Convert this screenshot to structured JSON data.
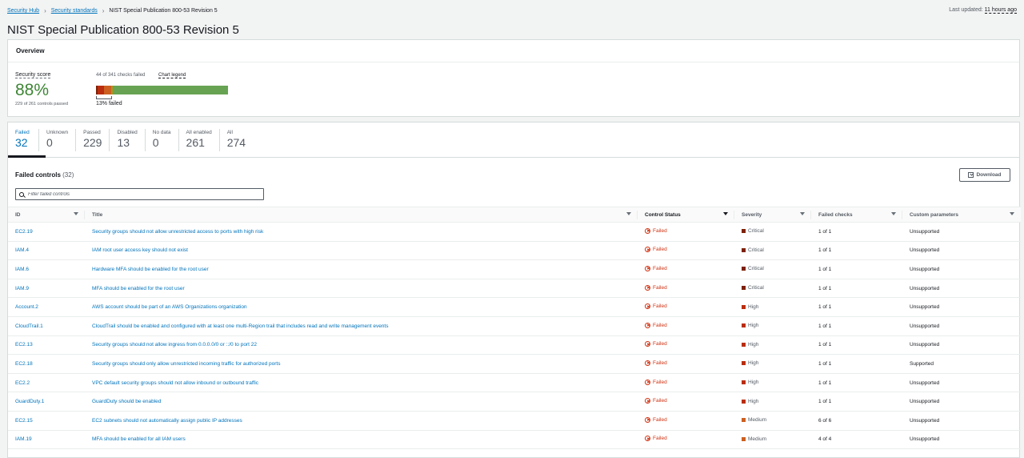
{
  "breadcrumb": {
    "items": [
      "Security Hub",
      "Security standards"
    ],
    "current": "NIST Special Publication 800-53 Revision 5"
  },
  "last_updated": {
    "label": "Last updated:",
    "value": "11 hours ago"
  },
  "page_title": "NIST Special Publication 800-53 Revision 5",
  "overview": {
    "header": "Overview",
    "score_label": "Security score",
    "score_value": "88%",
    "score_sub": "229 of 261 controls passed",
    "checks_failed": "44 of 341 checks failed",
    "chart_legend": "Chart legend",
    "failed_pct_label": "13% failed",
    "bar_segments": [
      {
        "severity": "critical",
        "fraction": 0.012,
        "color": "#7d2105"
      },
      {
        "severity": "high",
        "fraction": 0.05,
        "color": "#ba2e0f"
      },
      {
        "severity": "medium",
        "fraction": 0.055,
        "color": "#cc5f21"
      },
      {
        "severity": "low",
        "fraction": 0.013,
        "color": "#b2911c"
      },
      {
        "severity": "passed",
        "fraction": 0.87,
        "color": "#67a353"
      }
    ]
  },
  "tabs": [
    {
      "label": "Failed",
      "count": "32"
    },
    {
      "label": "Unknown",
      "count": "0"
    },
    {
      "label": "Passed",
      "count": "229"
    },
    {
      "label": "Disabled",
      "count": "13"
    },
    {
      "label": "No data",
      "count": "0"
    },
    {
      "label": "All enabled",
      "count": "261"
    },
    {
      "label": "All",
      "count": "274"
    }
  ],
  "failed_controls": {
    "title": "Failed controls",
    "count": "(32)",
    "download_label": "Download",
    "filter_placeholder": "Filter failed controls"
  },
  "columns": [
    "ID",
    "Title",
    "Control Status",
    "Severity",
    "Failed checks",
    "Custom parameters"
  ],
  "severity_colors": {
    "Critical": "#7d2105",
    "High": "#ba2e0f",
    "Medium": "#cc5f21"
  },
  "rows": [
    {
      "id": "EC2.19",
      "title": "Security groups should not allow unrestricted access to ports with high risk",
      "status": "Failed",
      "severity": "Critical",
      "failed_checks": "1 of 1",
      "custom": "Unsupported"
    },
    {
      "id": "IAM.4",
      "title": "IAM root user access key should not exist",
      "status": "Failed",
      "severity": "Critical",
      "failed_checks": "1 of 1",
      "custom": "Unsupported"
    },
    {
      "id": "IAM.6",
      "title": "Hardware MFA should be enabled for the root user",
      "status": "Failed",
      "severity": "Critical",
      "failed_checks": "1 of 1",
      "custom": "Unsupported"
    },
    {
      "id": "IAM.9",
      "title": "MFA should be enabled for the root user",
      "status": "Failed",
      "severity": "Critical",
      "failed_checks": "1 of 1",
      "custom": "Unsupported"
    },
    {
      "id": "Account.2",
      "title": "AWS account should be part of an AWS Organizations organization",
      "status": "Failed",
      "severity": "High",
      "failed_checks": "1 of 1",
      "custom": "Unsupported"
    },
    {
      "id": "CloudTrail.1",
      "title": "CloudTrail should be enabled and configured with at least one multi-Region trail that includes read and write management events",
      "status": "Failed",
      "severity": "High",
      "failed_checks": "1 of 1",
      "custom": "Unsupported"
    },
    {
      "id": "EC2.13",
      "title": "Security groups should not allow ingress from 0.0.0.0/0 or ::/0 to port 22",
      "status": "Failed",
      "severity": "High",
      "failed_checks": "1 of 1",
      "custom": "Unsupported"
    },
    {
      "id": "EC2.18",
      "title": "Security groups should only allow unrestricted incoming traffic for authorized ports",
      "status": "Failed",
      "severity": "High",
      "failed_checks": "1 of 1",
      "custom": "Supported"
    },
    {
      "id": "EC2.2",
      "title": "VPC default security groups should not allow inbound or outbound traffic",
      "status": "Failed",
      "severity": "High",
      "failed_checks": "1 of 1",
      "custom": "Unsupported"
    },
    {
      "id": "GuardDuty.1",
      "title": "GuardDuty should be enabled",
      "status": "Failed",
      "severity": "High",
      "failed_checks": "1 of 1",
      "custom": "Unsupported"
    },
    {
      "id": "EC2.15",
      "title": "EC2 subnets should not automatically assign public IP addresses",
      "status": "Failed",
      "severity": "Medium",
      "failed_checks": "6 of 6",
      "custom": "Unsupported"
    },
    {
      "id": "IAM.19",
      "title": "MFA should be enabled for all IAM users",
      "status": "Failed",
      "severity": "Medium",
      "failed_checks": "4 of 4",
      "custom": "Unsupported"
    }
  ]
}
